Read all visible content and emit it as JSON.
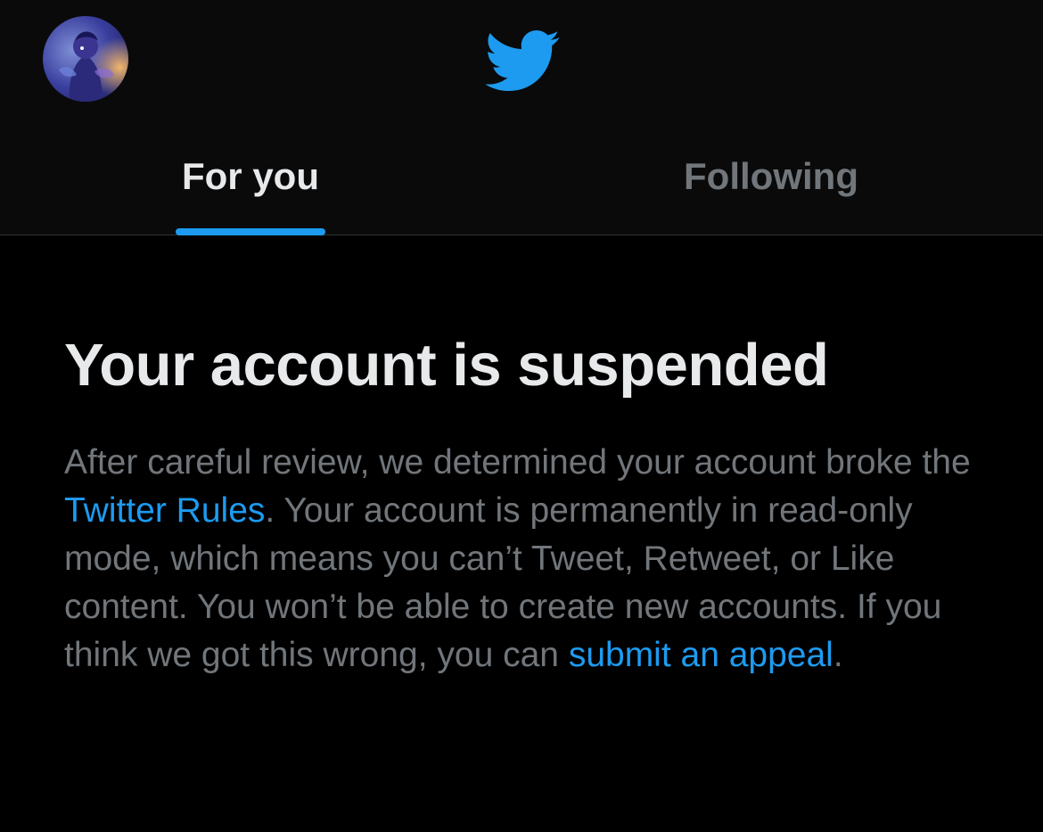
{
  "colors": {
    "background": "#000000",
    "header_background": "#0a0a0b",
    "primary_text": "#e7e9ea",
    "secondary_text": "#71767b",
    "accent": "#1d9bf0",
    "divider": "#2f3336"
  },
  "header": {
    "avatar_icon": "user-avatar",
    "logo_icon": "twitter-bird-icon",
    "tabs": [
      {
        "label": "For you",
        "selected": true
      },
      {
        "label": "Following",
        "selected": false
      }
    ]
  },
  "notice": {
    "title": "Your account is suspended",
    "body": {
      "part1": "After careful review, we determined your account broke the ",
      "rules_link": "Twitter Rules",
      "part2": ". Your account is permanently in read-only mode, which means you can’t Tweet, Retweet, or Like content. You won’t be able to create new accounts. If you think we got this wrong, you can ",
      "appeal_link": "submit an appeal",
      "part3": "."
    }
  }
}
